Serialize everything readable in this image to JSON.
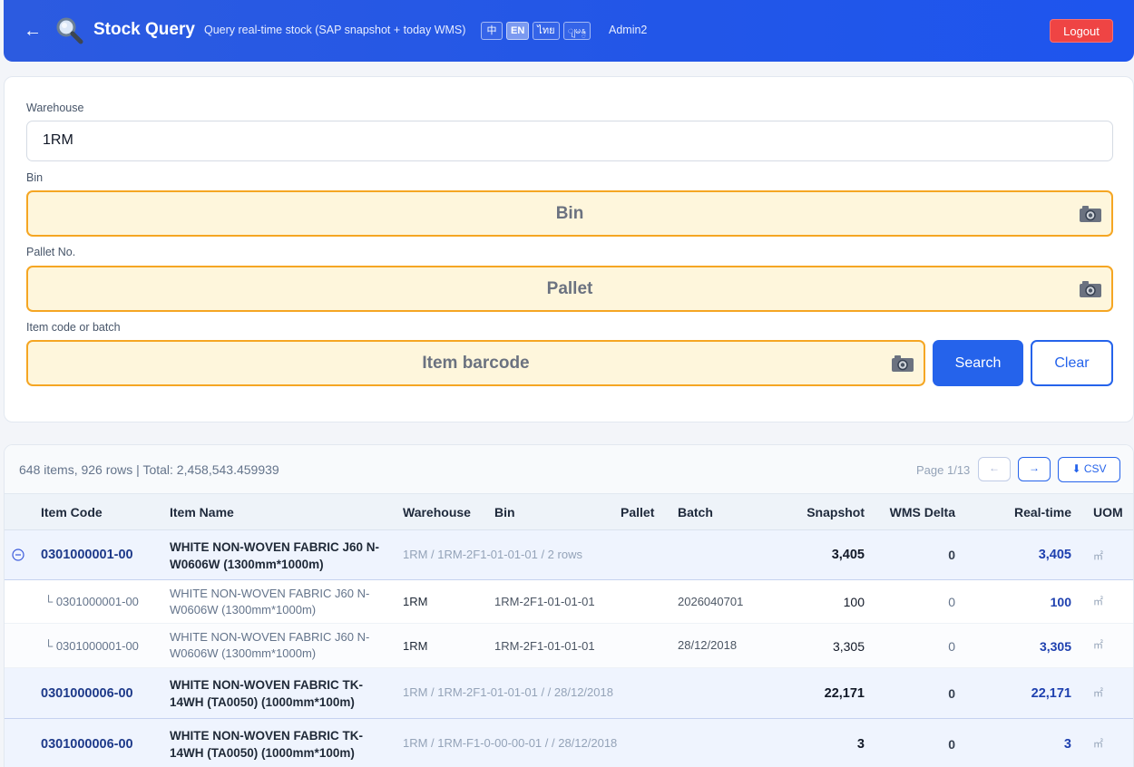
{
  "header": {
    "back_icon": "arrow-left-icon",
    "app_icon": "magnifier-icon",
    "title": "Stock Query",
    "subtitle": "Query real-time stock (SAP snapshot + today WMS)",
    "languages": [
      "中",
      "EN",
      "ไทย",
      "ျမန္"
    ],
    "active_language": "EN",
    "user": "Admin2",
    "logout_label": "Logout"
  },
  "form": {
    "warehouse_label": "Warehouse",
    "warehouse_value": "1RM",
    "bin_label": "Bin",
    "bin_placeholder": "Bin",
    "pallet_label": "Pallet No.",
    "pallet_placeholder": "Pallet",
    "item_label": "Item code or batch",
    "item_placeholder": "Item barcode",
    "camera_icon": "camera-icon",
    "search_label": "Search",
    "clear_label": "Clear"
  },
  "results": {
    "summary": "648 items, 926 rows | Total: 2,458,543.459939",
    "page_info": "Page 1/13",
    "prev_label": "←",
    "next_label": "→",
    "csv_label": "⬇ CSV",
    "columns": [
      "Item Code",
      "Item Name",
      "Warehouse",
      "Bin",
      "Pallet",
      "Batch",
      "Snapshot",
      "WMS Delta",
      "Real-time",
      "UOM"
    ],
    "groups": [
      {
        "code": "0301000001-00",
        "name": "WHITE NON-WOVEN FABRIC J60 N-W0606W (1300mm*1000m)",
        "location": "1RM / 1RM-2F1-01-01-01 / 2 rows",
        "snapshot": "3,405",
        "delta": "0",
        "realtime": "3,405",
        "uom": "㎡",
        "expanded": true,
        "details": [
          {
            "code": "└ 0301000001-00",
            "name": "WHITE NON-WOVEN FABRIC J60 N-W0606W (1300mm*1000m)",
            "warehouse": "1RM",
            "bin": "1RM-2F1-01-01-01",
            "pallet": "",
            "batch": "2026040701",
            "snapshot": "100",
            "delta": "0",
            "realtime": "100",
            "uom": "㎡"
          },
          {
            "code": "└ 0301000001-00",
            "name": "WHITE NON-WOVEN FABRIC J60 N-W0606W (1300mm*1000m)",
            "warehouse": "1RM",
            "bin": "1RM-2F1-01-01-01",
            "pallet": "",
            "batch": "28/12/2018",
            "snapshot": "3,305",
            "delta": "0",
            "realtime": "3,305",
            "uom": "㎡"
          }
        ]
      },
      {
        "code": "0301000006-00",
        "name": "WHITE NON-WOVEN FABRIC TK-14WH (TA0050) (1000mm*100m)",
        "location": "1RM / 1RM-2F1-01-01-01 / / 28/12/2018",
        "snapshot": "22,171",
        "delta": "0",
        "realtime": "22,171",
        "uom": "㎡",
        "expanded": false
      },
      {
        "code": "0301000006-00",
        "name": "WHITE NON-WOVEN FABRIC TK-14WH (TA0050) (1000mm*100m)",
        "location": "1RM / 1RM-F1-0-00-00-01 / / 28/12/2018",
        "snapshot": "3",
        "delta": "0",
        "realtime": "3",
        "uom": "㎡",
        "expanded": false
      }
    ]
  }
}
